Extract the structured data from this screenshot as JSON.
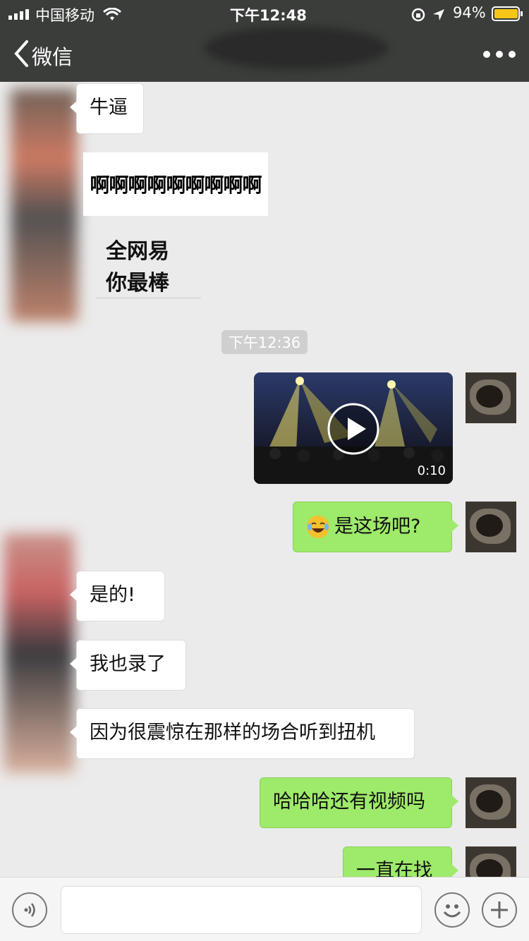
{
  "status_bar": {
    "carrier": "中国移动",
    "time": "下午12:48",
    "battery": "94%"
  },
  "nav": {
    "back_label": "微信"
  },
  "messages": {
    "m1": "牛逼",
    "sticker1": "啊啊啊啊啊啊啊啊啊",
    "sticker2_line1": "全网易",
    "sticker2_line2": "你最棒",
    "timestamp": "下午12:36",
    "video_duration": "0:10",
    "m2": "是这场吧?",
    "m3": "是的!",
    "m4": "我也录了",
    "m5": "因为很震惊在那样的场合听到扭机",
    "m6": "哈哈哈还有视频吗",
    "m7": "一直在找"
  },
  "colors": {
    "outgoing": "#9eea6a",
    "incoming": "#ffffff",
    "nav": "#3a3d3a"
  }
}
